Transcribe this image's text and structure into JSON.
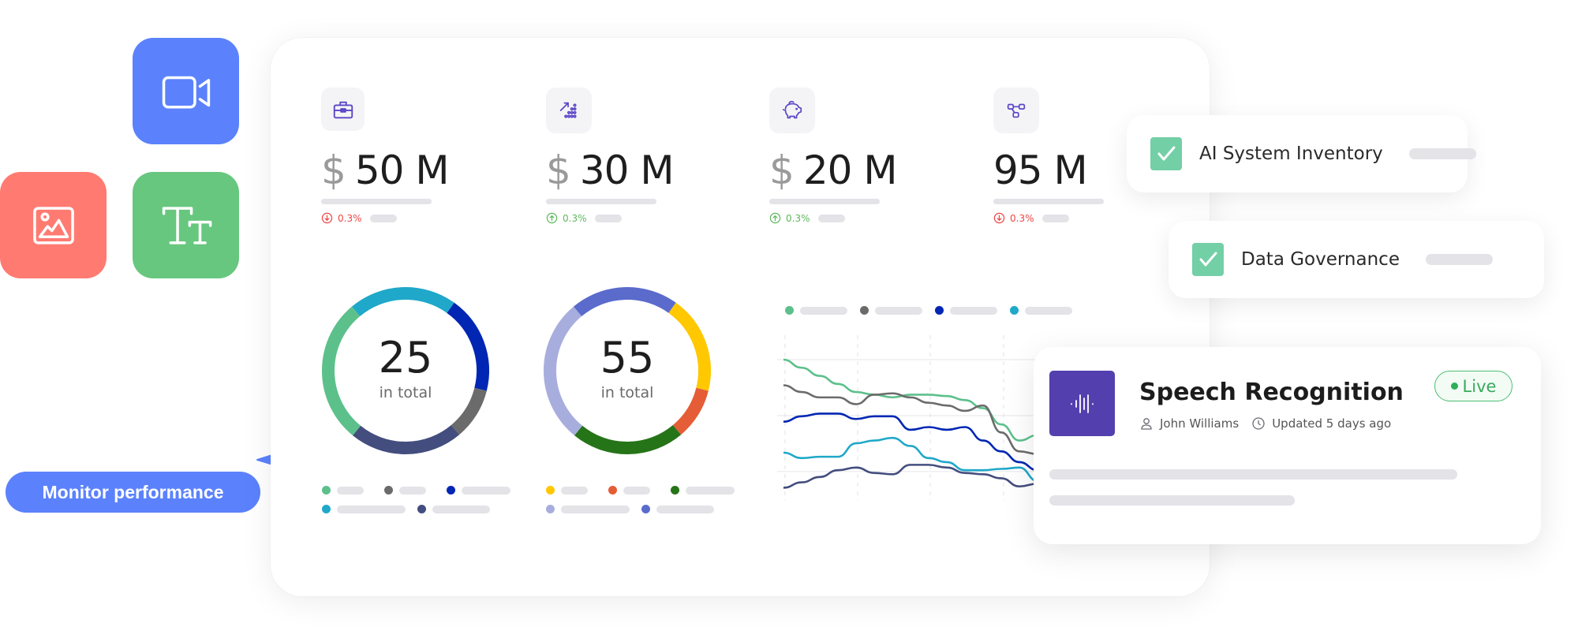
{
  "tiles": [
    {
      "name": "video",
      "icon": "video-camera-icon",
      "color": "#5b82fc"
    },
    {
      "name": "image",
      "icon": "image-icon",
      "color": "#ff7b72"
    },
    {
      "name": "text",
      "icon": "text-size-icon",
      "color": "#67c77f"
    }
  ],
  "cta": {
    "label": "Monitor performance",
    "color": "#5b82fc"
  },
  "kpis": [
    {
      "icon": "briefcase-icon",
      "currency": "$",
      "value": "50 M",
      "trend": "down",
      "change": "0.3%"
    },
    {
      "icon": "growth-chart-icon",
      "currency": "$",
      "value": "30 M",
      "trend": "up",
      "change": "0.3%"
    },
    {
      "icon": "piggy-bank-icon",
      "currency": "$",
      "value": "20 M",
      "trend": "up",
      "change": "0.3%"
    },
    {
      "icon": "network-nodes-icon",
      "currency": "",
      "value": "95 M",
      "trend": "down",
      "change": "0.3%"
    }
  ],
  "colors": {
    "up": "#5cb85c",
    "down": "#ef4444",
    "icon": "#5a45c6"
  },
  "checklist": [
    {
      "label": "AI System Inventory",
      "checked": true
    },
    {
      "label": "Data Governance",
      "checked": true
    }
  ],
  "speech_card": {
    "title": "Speech Recognition",
    "owner": "John Williams",
    "updated": "Updated 5 days ago",
    "status": "Live",
    "icon": "sound-wave-icon"
  },
  "chart_data": [
    {
      "type": "pie",
      "title": "",
      "center_value": "25",
      "center_label": "in total",
      "donut": true,
      "slices": [
        {
          "color": "#1fa8c9",
          "value": 21
        },
        {
          "color": "#0026b3",
          "value": 19
        },
        {
          "color": "#6b6b6b",
          "value": 10
        },
        {
          "color": "#434d7e",
          "value": 22
        },
        {
          "color": "#5cc08b",
          "value": 28
        }
      ],
      "legend": [
        {
          "color": "#5cc08b"
        },
        {
          "color": "#6b6b6b"
        },
        {
          "color": "#0026b3"
        },
        {
          "color": "#1fa8c9"
        },
        {
          "color": "#434d7e"
        }
      ]
    },
    {
      "type": "pie",
      "title": "",
      "center_value": "55",
      "center_label": "in total",
      "donut": true,
      "slices": [
        {
          "color": "#5a6bcc",
          "value": 21
        },
        {
          "color": "#ffc800",
          "value": 19
        },
        {
          "color": "#e45d37",
          "value": 10
        },
        {
          "color": "#267418",
          "value": 22
        },
        {
          "color": "#a7aedd",
          "value": 28
        }
      ],
      "legend": [
        {
          "color": "#ffc800"
        },
        {
          "color": "#e45d37"
        },
        {
          "color": "#267418"
        },
        {
          "color": "#a7aedd"
        },
        {
          "color": "#5a6bcc"
        }
      ]
    },
    {
      "type": "line",
      "title": "",
      "xlabel": "",
      "ylabel": "",
      "grid": true,
      "ylim": [
        0,
        100
      ],
      "x": [
        0,
        1,
        2,
        3,
        4,
        5,
        6,
        7,
        8,
        9,
        10,
        11,
        12,
        13,
        14
      ],
      "series": [
        {
          "name": "",
          "color": "#5cc08b",
          "values": [
            100,
            94,
            88,
            82,
            76,
            74,
            72,
            74,
            74,
            73,
            70,
            64,
            52,
            40,
            44
          ]
        },
        {
          "name": "",
          "color": "#6b6b6b",
          "values": [
            81,
            76,
            72,
            72,
            67,
            74,
            75,
            72,
            68,
            66,
            62,
            66,
            46,
            32,
            30
          ]
        },
        {
          "name": "",
          "color": "#0026b3",
          "values": [
            54,
            58,
            60,
            60,
            56,
            58,
            58,
            48,
            50,
            48,
            50,
            40,
            32,
            24,
            18
          ]
        },
        {
          "name": "",
          "color": "#1fa8c9",
          "values": [
            31,
            27,
            28,
            28,
            38,
            40,
            42,
            36,
            27,
            24,
            18,
            18,
            19,
            20,
            10
          ]
        },
        {
          "name": "",
          "color": "#434d7e",
          "values": [
            5,
            9,
            13,
            18,
            20,
            16,
            15,
            22,
            22,
            20,
            16,
            15,
            12,
            6,
            8
          ]
        }
      ],
      "legend": [
        {
          "color": "#5cc08b"
        },
        {
          "color": "#6b6b6b"
        },
        {
          "color": "#0026b3"
        },
        {
          "color": "#1fa8c9"
        }
      ]
    }
  ]
}
